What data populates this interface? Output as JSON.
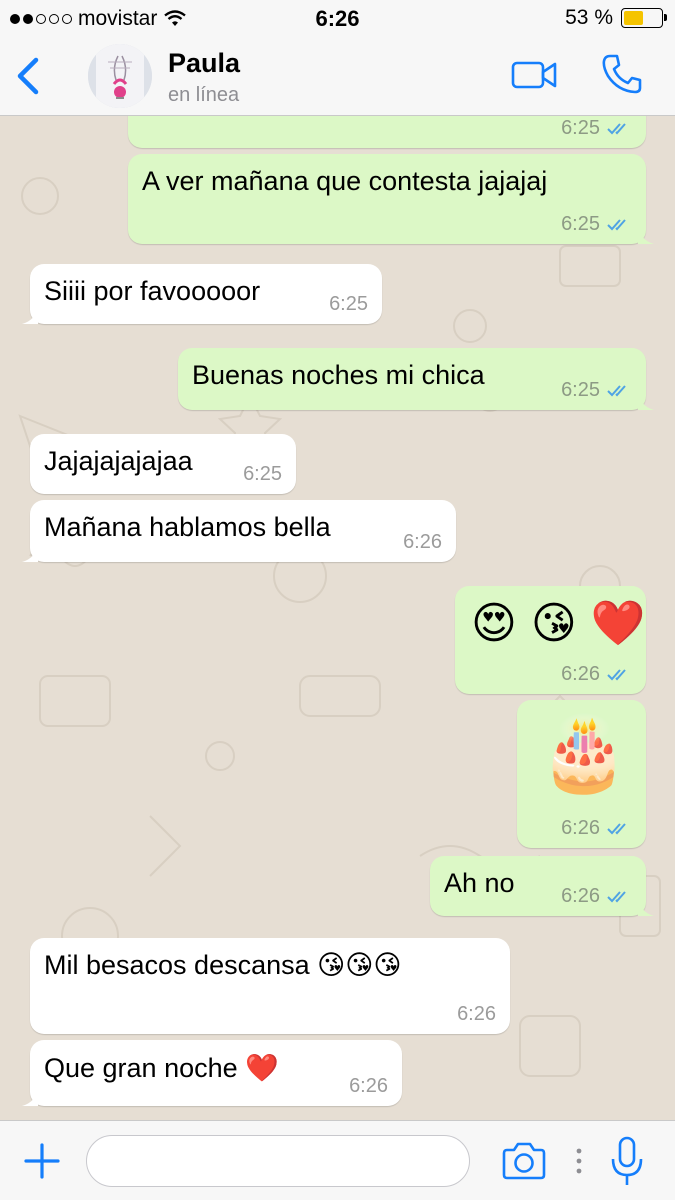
{
  "status_bar": {
    "carrier": "movistar",
    "time": "6:26",
    "battery": "53 %",
    "battery_level": 0.53
  },
  "header": {
    "back_icon": "chevron-left-icon",
    "contact_name": "Paula",
    "contact_status": "en línea",
    "video_icon": "video-camera-icon",
    "call_icon": "phone-icon"
  },
  "messages": [
    {
      "direction": "out",
      "text": "",
      "time": "6:25",
      "read": true
    },
    {
      "direction": "out",
      "text": "A ver mañana que contesta jajajaj",
      "time": "6:25",
      "read": true
    },
    {
      "direction": "in",
      "text": "Siiii por favooooor",
      "time": "6:25"
    },
    {
      "direction": "out",
      "text": "Buenas noches mi chica",
      "time": "6:25",
      "read": true
    },
    {
      "direction": "in",
      "text": "Jajajajajajaa",
      "time": "6:25"
    },
    {
      "direction": "in",
      "text": "Mañana hablamos bella",
      "time": "6:26"
    },
    {
      "direction": "out",
      "text": "😍 😘 ❤️",
      "time": "6:26",
      "read": true,
      "emojis": [
        "😍",
        "😘",
        "❤️"
      ]
    },
    {
      "direction": "out",
      "text": "🎂",
      "time": "6:26",
      "read": true,
      "emojis": [
        "🎂"
      ]
    },
    {
      "direction": "out",
      "text": "Ah no",
      "time": "6:26",
      "read": true
    },
    {
      "direction": "in",
      "text": "Mil besacos descansa 😘😘😘",
      "time": "6:26"
    },
    {
      "direction": "in",
      "text": "Que gran noche ❤️",
      "time": "6:26"
    }
  ],
  "input_bar": {
    "plus_icon": "plus-icon",
    "placeholder": "",
    "camera_icon": "camera-icon",
    "mic_icon": "microphone-icon"
  },
  "colors": {
    "accent": "#157efb",
    "outgoing_bubble": "#dcf8c6",
    "incoming_bubble": "#ffffff",
    "chat_background": "#e6ded3",
    "read_ticks": "#4fa3e4"
  }
}
